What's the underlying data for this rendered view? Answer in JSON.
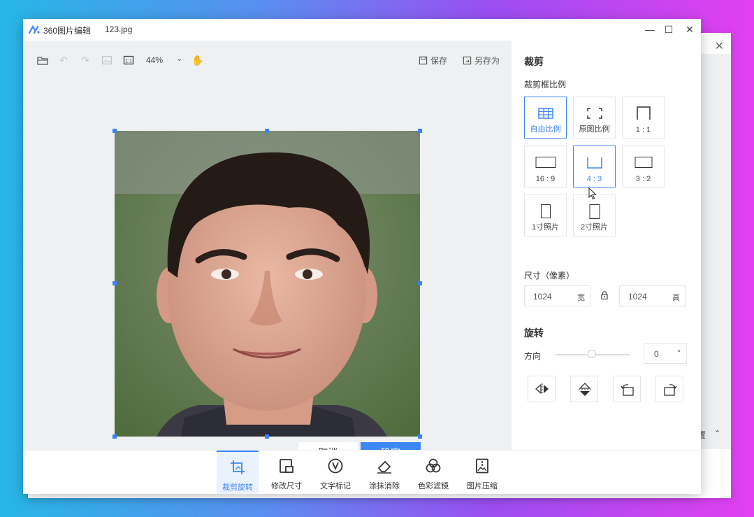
{
  "app": {
    "name": "360图片编辑",
    "file_name": "123.jpg"
  },
  "toolbar": {
    "zoom": "44%",
    "save_label": "保存",
    "save_as_label": "另存为"
  },
  "crop_actions": {
    "cancel_label": "取消",
    "confirm_label": "确定"
  },
  "panel": {
    "title": "裁剪",
    "ratio_section_label": "裁剪框比例",
    "ratios": [
      {
        "label": "自由比例",
        "active": true
      },
      {
        "label": "原图比例",
        "active": false
      },
      {
        "label": "1 : 1",
        "active": false
      },
      {
        "label": "16 : 9",
        "active": false
      },
      {
        "label": "4 : 3",
        "active": true
      },
      {
        "label": "3 : 2",
        "active": false
      },
      {
        "label": "1寸照片",
        "active": false
      },
      {
        "label": "2寸照片",
        "active": false
      }
    ],
    "size_section_label": "尺寸（像素）",
    "width_value": "1024",
    "width_unit": "宽",
    "height_value": "1024",
    "height_unit": "高",
    "rotate_section_label": "旋转",
    "direction_label": "方向",
    "angle_value": "0",
    "angle_unit": "°"
  },
  "bottom_tools": [
    {
      "label": "裁剪旋转",
      "icon": "crop-icon",
      "active": true
    },
    {
      "label": "修改尺寸",
      "icon": "resize-icon",
      "active": false
    },
    {
      "label": "文字标记",
      "icon": "text-mark-icon",
      "active": false
    },
    {
      "label": "涂抹消除",
      "icon": "eraser-icon",
      "active": false
    },
    {
      "label": "色彩滤镜",
      "icon": "color-filter-icon",
      "active": false
    },
    {
      "label": "图片压缩",
      "icon": "compress-icon",
      "active": false
    }
  ],
  "background_window": {
    "fragment_text": "置"
  },
  "colors": {
    "accent": "#3d86f5",
    "canvas_bg": "#eef0f2",
    "handle": "#3b82f6"
  }
}
